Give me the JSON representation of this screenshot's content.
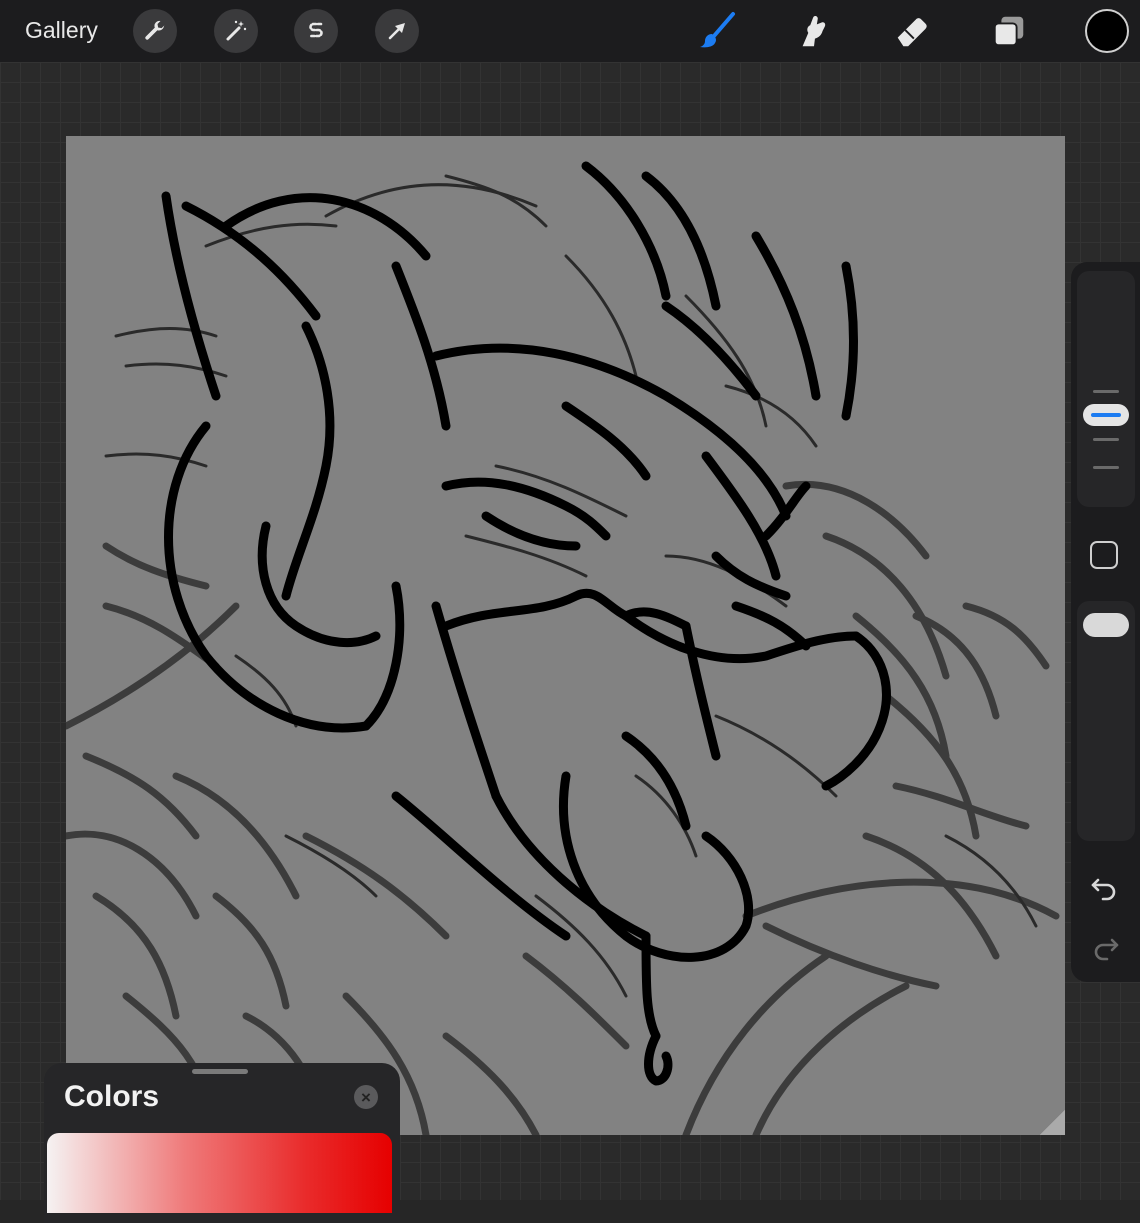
{
  "toolbar": {
    "gallery_label": "Gallery",
    "left_tools": [
      {
        "name": "actions",
        "icon": "wrench-icon"
      },
      {
        "name": "adjustments",
        "icon": "magic-wand-icon"
      },
      {
        "name": "selection",
        "icon": "selection-s-icon"
      },
      {
        "name": "transform",
        "icon": "arrow-cursor-icon"
      }
    ],
    "right_tools": [
      {
        "name": "brush",
        "icon": "brush-icon",
        "active": true
      },
      {
        "name": "smudge",
        "icon": "smudge-finger-icon",
        "active": false
      },
      {
        "name": "eraser",
        "icon": "eraser-icon",
        "active": false
      },
      {
        "name": "layers",
        "icon": "layers-icon",
        "active": false
      }
    ],
    "current_color": "#000000",
    "active_color": "#1c7cf2"
  },
  "sidebar": {
    "size_slider": "brush-size",
    "modify_button": "square-icon",
    "opacity_slider": "brush-opacity",
    "undo_icon": "undo-icon",
    "redo_icon": "redo-icon"
  },
  "colors_panel": {
    "title": "Colors",
    "close_icon": "close-icon",
    "hue_color": "#e60000"
  }
}
